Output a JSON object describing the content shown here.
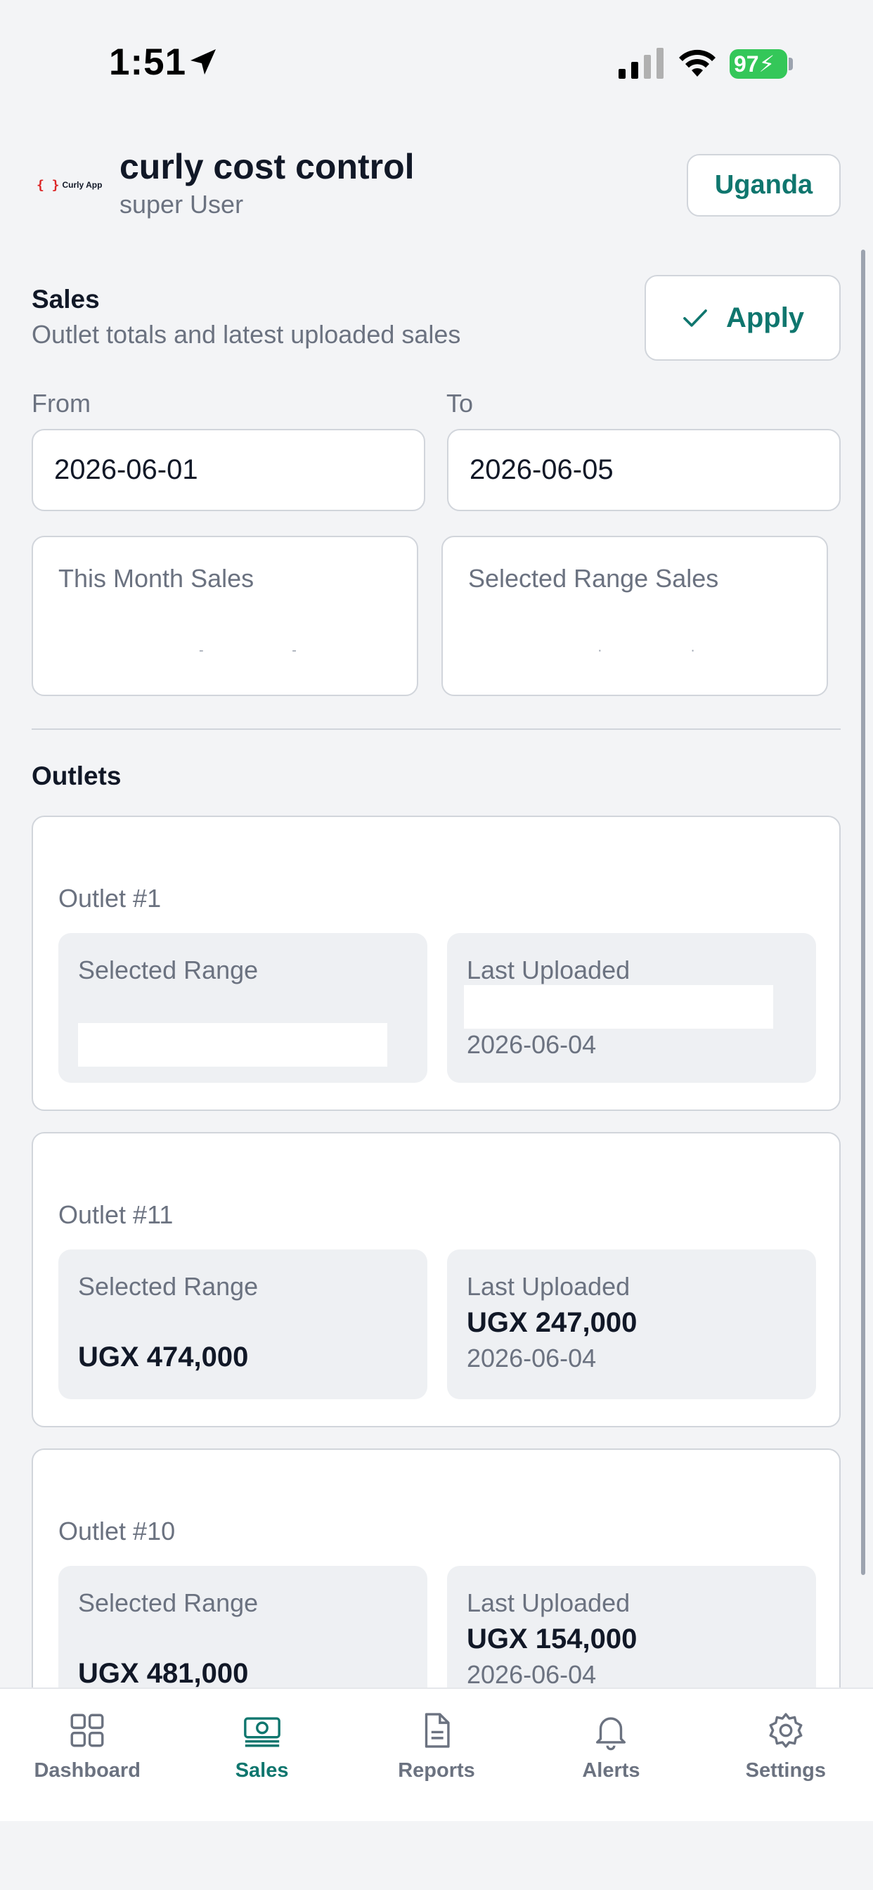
{
  "status_bar": {
    "time": "1:51",
    "battery": "97",
    "icons": [
      "location-arrow-icon",
      "cellular-signal-icon",
      "wifi-icon",
      "battery-icon"
    ]
  },
  "header": {
    "logo_braces": "{ }",
    "logo_text": "Curly App",
    "title": "curly cost control",
    "subtitle": "super User",
    "region_button": "Uganda"
  },
  "sales": {
    "title": "Sales",
    "subtitle": "Outlet totals and latest uploaded sales",
    "apply_label": "Apply",
    "from_label": "From",
    "to_label": "To",
    "from_value": "2026-06-01",
    "to_value": "2026-06-05",
    "cards": [
      {
        "label": "This Month Sales"
      },
      {
        "label": "Selected Range Sales"
      }
    ]
  },
  "outlets": {
    "title": "Outlets",
    "items": [
      {
        "name": "Outlet #1",
        "selected_label": "Selected Range",
        "selected_value": "",
        "last_label": "Last Uploaded",
        "last_amount": "",
        "last_date": "2026-06-04"
      },
      {
        "name": "Outlet #11",
        "selected_label": "Selected Range",
        "selected_value": "UGX 474,000",
        "last_label": "Last Uploaded",
        "last_amount": "UGX 247,000",
        "last_date": "2026-06-04"
      },
      {
        "name": "Outlet #10",
        "selected_label": "Selected Range",
        "selected_value": "UGX 481,000",
        "last_label": "Last Uploaded",
        "last_amount": "UGX 154,000",
        "last_date": "2026-06-04"
      }
    ]
  },
  "nav": {
    "items": [
      {
        "label": "Dashboard",
        "icon": "grid-icon"
      },
      {
        "label": "Sales",
        "icon": "cash-icon",
        "active": true
      },
      {
        "label": "Reports",
        "icon": "document-icon"
      },
      {
        "label": "Alerts",
        "icon": "bell-icon"
      },
      {
        "label": "Settings",
        "icon": "gear-icon"
      }
    ]
  },
  "colors": {
    "accent": "#0f766e",
    "text": "#111827",
    "muted": "#6b7280",
    "border": "#d1d5db",
    "background": "#f3f4f6",
    "battery": "#34c759"
  }
}
